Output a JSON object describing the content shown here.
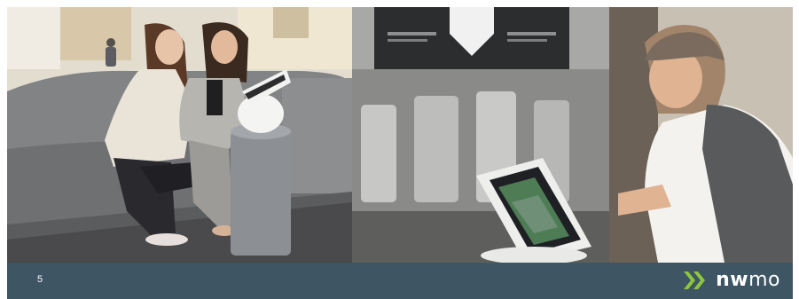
{
  "slide": {
    "page_number": "5",
    "logo": {
      "text_bold": "nw",
      "text_light": "mo",
      "icon": "double-chevron-icon",
      "accent_color": "#8dc63f",
      "footer_color": "#3e5563"
    },
    "photos": [
      {
        "name": "people-at-kiosk-photo"
      },
      {
        "name": "man-using-tablet-photo"
      }
    ]
  }
}
